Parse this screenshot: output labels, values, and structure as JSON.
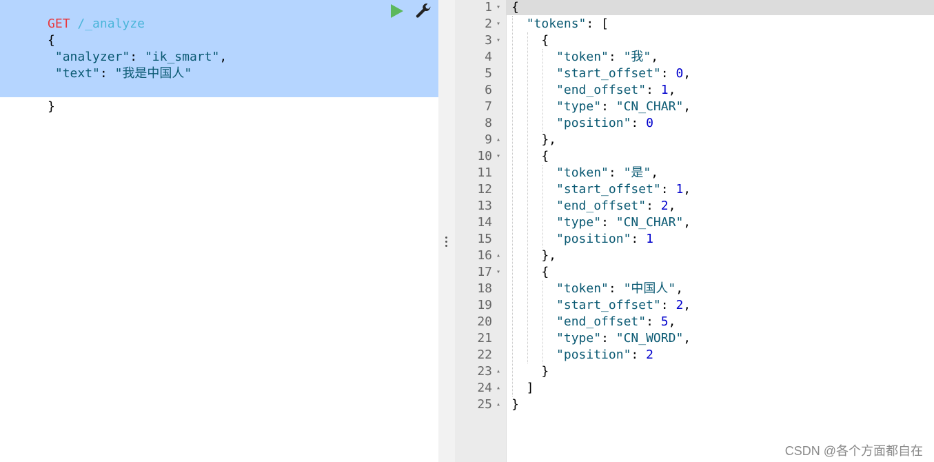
{
  "request": {
    "method": "GET",
    "path": " /_analyze",
    "lines": [
      {
        "text": "{"
      },
      {
        "key": "\"analyzer\"",
        "sep": ": ",
        "value": "\"ik_smart\"",
        "tail": ","
      },
      {
        "key": "\"text\"",
        "sep": ": ",
        "value": "\"我是中国人\"",
        "tail": ""
      },
      {
        "text": ""
      },
      {
        "text": "}"
      }
    ]
  },
  "toolbar": {
    "run_icon": "play-icon",
    "settings_icon": "wrench-icon"
  },
  "response": {
    "lines": [
      {
        "n": "1",
        "fold": "▾",
        "parts": [
          [
            "punct",
            "{"
          ]
        ]
      },
      {
        "n": "2",
        "fold": "▾",
        "parts": [
          [
            "punct",
            "  "
          ],
          [
            "key",
            "\"tokens\""
          ],
          [
            "punct",
            ": ["
          ]
        ]
      },
      {
        "n": "3",
        "fold": "▾",
        "parts": [
          [
            "punct",
            "    {"
          ]
        ]
      },
      {
        "n": "4",
        "fold": "",
        "parts": [
          [
            "punct",
            "      "
          ],
          [
            "key",
            "\"token\""
          ],
          [
            "punct",
            ": "
          ],
          [
            "str",
            "\"我\""
          ],
          [
            "punct",
            ","
          ]
        ]
      },
      {
        "n": "5",
        "fold": "",
        "parts": [
          [
            "punct",
            "      "
          ],
          [
            "key",
            "\"start_offset\""
          ],
          [
            "punct",
            ": "
          ],
          [
            "num",
            "0"
          ],
          [
            "punct",
            ","
          ]
        ]
      },
      {
        "n": "6",
        "fold": "",
        "parts": [
          [
            "punct",
            "      "
          ],
          [
            "key",
            "\"end_offset\""
          ],
          [
            "punct",
            ": "
          ],
          [
            "num",
            "1"
          ],
          [
            "punct",
            ","
          ]
        ]
      },
      {
        "n": "7",
        "fold": "",
        "parts": [
          [
            "punct",
            "      "
          ],
          [
            "key",
            "\"type\""
          ],
          [
            "punct",
            ": "
          ],
          [
            "str",
            "\"CN_CHAR\""
          ],
          [
            "punct",
            ","
          ]
        ]
      },
      {
        "n": "8",
        "fold": "",
        "parts": [
          [
            "punct",
            "      "
          ],
          [
            "key",
            "\"position\""
          ],
          [
            "punct",
            ": "
          ],
          [
            "num",
            "0"
          ]
        ]
      },
      {
        "n": "9",
        "fold": "▴",
        "parts": [
          [
            "punct",
            "    },"
          ]
        ]
      },
      {
        "n": "10",
        "fold": "▾",
        "parts": [
          [
            "punct",
            "    {"
          ]
        ]
      },
      {
        "n": "11",
        "fold": "",
        "parts": [
          [
            "punct",
            "      "
          ],
          [
            "key",
            "\"token\""
          ],
          [
            "punct",
            ": "
          ],
          [
            "str",
            "\"是\""
          ],
          [
            "punct",
            ","
          ]
        ]
      },
      {
        "n": "12",
        "fold": "",
        "parts": [
          [
            "punct",
            "      "
          ],
          [
            "key",
            "\"start_offset\""
          ],
          [
            "punct",
            ": "
          ],
          [
            "num",
            "1"
          ],
          [
            "punct",
            ","
          ]
        ]
      },
      {
        "n": "13",
        "fold": "",
        "parts": [
          [
            "punct",
            "      "
          ],
          [
            "key",
            "\"end_offset\""
          ],
          [
            "punct",
            ": "
          ],
          [
            "num",
            "2"
          ],
          [
            "punct",
            ","
          ]
        ]
      },
      {
        "n": "14",
        "fold": "",
        "parts": [
          [
            "punct",
            "      "
          ],
          [
            "key",
            "\"type\""
          ],
          [
            "punct",
            ": "
          ],
          [
            "str",
            "\"CN_CHAR\""
          ],
          [
            "punct",
            ","
          ]
        ]
      },
      {
        "n": "15",
        "fold": "",
        "parts": [
          [
            "punct",
            "      "
          ],
          [
            "key",
            "\"position\""
          ],
          [
            "punct",
            ": "
          ],
          [
            "num",
            "1"
          ]
        ]
      },
      {
        "n": "16",
        "fold": "▴",
        "parts": [
          [
            "punct",
            "    },"
          ]
        ]
      },
      {
        "n": "17",
        "fold": "▾",
        "parts": [
          [
            "punct",
            "    {"
          ]
        ]
      },
      {
        "n": "18",
        "fold": "",
        "parts": [
          [
            "punct",
            "      "
          ],
          [
            "key",
            "\"token\""
          ],
          [
            "punct",
            ": "
          ],
          [
            "str",
            "\"中国人\""
          ],
          [
            "punct",
            ","
          ]
        ]
      },
      {
        "n": "19",
        "fold": "",
        "parts": [
          [
            "punct",
            "      "
          ],
          [
            "key",
            "\"start_offset\""
          ],
          [
            "punct",
            ": "
          ],
          [
            "num",
            "2"
          ],
          [
            "punct",
            ","
          ]
        ]
      },
      {
        "n": "20",
        "fold": "",
        "parts": [
          [
            "punct",
            "      "
          ],
          [
            "key",
            "\"end_offset\""
          ],
          [
            "punct",
            ": "
          ],
          [
            "num",
            "5"
          ],
          [
            "punct",
            ","
          ]
        ]
      },
      {
        "n": "21",
        "fold": "",
        "parts": [
          [
            "punct",
            "      "
          ],
          [
            "key",
            "\"type\""
          ],
          [
            "punct",
            ": "
          ],
          [
            "str",
            "\"CN_WORD\""
          ],
          [
            "punct",
            ","
          ]
        ]
      },
      {
        "n": "22",
        "fold": "",
        "parts": [
          [
            "punct",
            "      "
          ],
          [
            "key",
            "\"position\""
          ],
          [
            "punct",
            ": "
          ],
          [
            "num",
            "2"
          ]
        ]
      },
      {
        "n": "23",
        "fold": "▴",
        "parts": [
          [
            "punct",
            "    }"
          ]
        ]
      },
      {
        "n": "24",
        "fold": "▴",
        "parts": [
          [
            "punct",
            "  ]"
          ]
        ]
      },
      {
        "n": "25",
        "fold": "▴",
        "parts": [
          [
            "punct",
            "}"
          ]
        ]
      }
    ]
  },
  "watermark": "CSDN @各个方面都自在",
  "colors": {
    "request_selection": "#b5d5ff",
    "method": "#e8383d",
    "url": "#4ab5d9",
    "key": "#0b5a73",
    "number": "#0000cc",
    "run_icon": "#5cb85c"
  }
}
